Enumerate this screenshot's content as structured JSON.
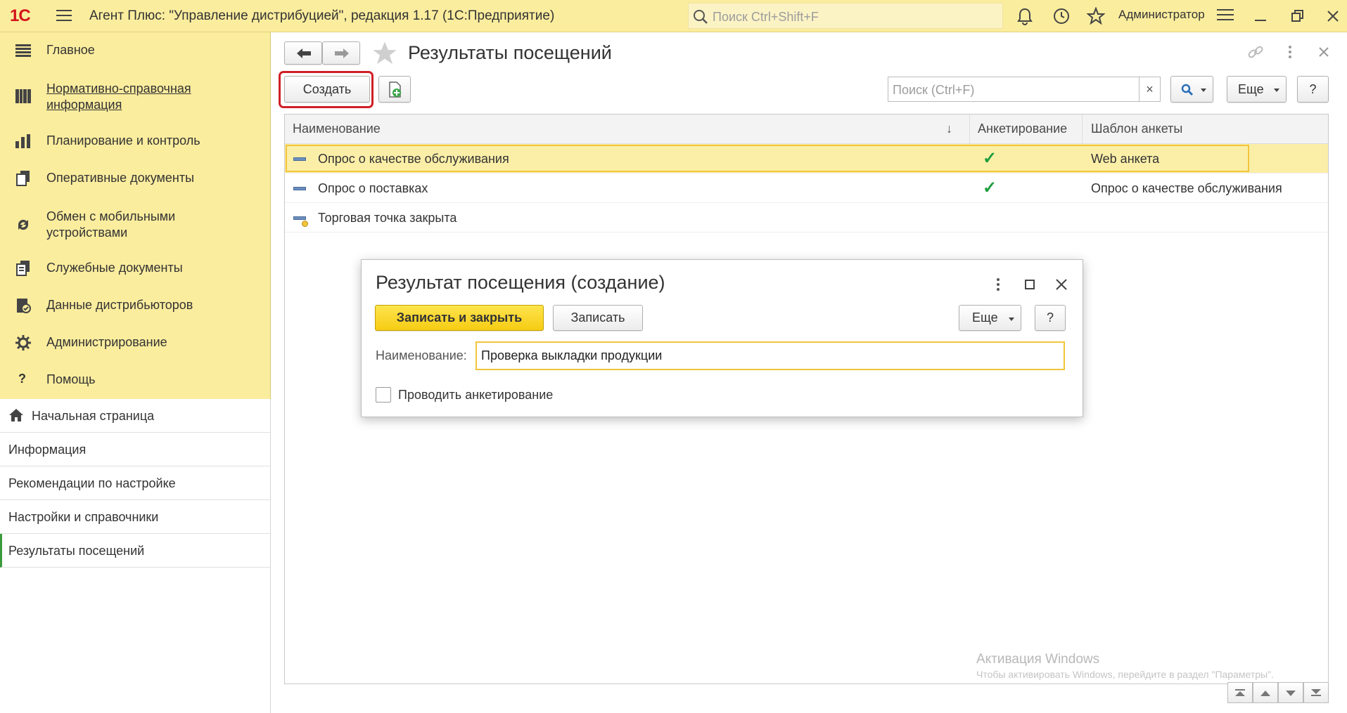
{
  "topbar": {
    "logo": "1С",
    "title": "Агент Плюс: \"Управление дистрибуцией\", редакция 1.17  (1С:Предприятие)",
    "search_placeholder": "Поиск Ctrl+Shift+F",
    "user": "Администратор"
  },
  "sidebar": {
    "items": [
      {
        "label": "Главное",
        "icon": "menu-lines-icon"
      },
      {
        "label": "Нормативно-справочная информация",
        "icon": "grid-books-icon"
      },
      {
        "label": "Планирование и контроль",
        "icon": "bar-chart-icon"
      },
      {
        "label": "Оперативные документы",
        "icon": "documents-icon"
      },
      {
        "label": "Обмен с мобильными устройствами",
        "icon": "sync-icon"
      },
      {
        "label": "Служебные документы",
        "icon": "service-docs-icon"
      },
      {
        "label": "Данные дистрибьюторов",
        "icon": "distributor-icon"
      },
      {
        "label": "Администрирование",
        "icon": "gear-icon"
      },
      {
        "label": "Помощь",
        "icon": "question-icon"
      }
    ]
  },
  "sections": [
    {
      "label": "Начальная страница",
      "icon": "home-icon"
    },
    {
      "label": "Информация"
    },
    {
      "label": "Рекомендации по настройке"
    },
    {
      "label": "Настройки и справочники"
    },
    {
      "label": "Результаты посещений"
    }
  ],
  "page": {
    "title": "Результаты посещений",
    "create_label": "Создать",
    "search_placeholder": "Поиск (Ctrl+F)",
    "clear_label": "×",
    "more_label": "Еще",
    "help_label": "?"
  },
  "grid": {
    "columns": [
      "Наименование",
      "Анкетирование",
      "Шаблон анкеты"
    ],
    "sort_glyph": "↓",
    "rows": [
      {
        "name": "Опрос о качестве обслуживания",
        "survey": true,
        "template": "Web анкета"
      },
      {
        "name": "Опрос о поставках",
        "survey": true,
        "template": "Опрос о качестве обслуживания"
      },
      {
        "name": "Торговая точка закрыта",
        "survey": false,
        "template": ""
      }
    ]
  },
  "dialog": {
    "title": "Результат посещения (создание)",
    "save_close_label": "Записать и закрыть",
    "save_label": "Записать",
    "more_label": "Еще",
    "help_label": "?",
    "name_label": "Наименование:",
    "name_value": "Проверка выкладки продукции",
    "survey_checkbox_label": "Проводить анкетирование"
  },
  "watermark": {
    "line1": "Активация Windows",
    "line2": "Чтобы активировать Windows, перейдите в раздел \"Параметры\"."
  },
  "colors": {
    "panel": "#fbed9e",
    "accent": "#f6cc14",
    "highlight": "#d01f26",
    "check": "#1e9e3e"
  }
}
